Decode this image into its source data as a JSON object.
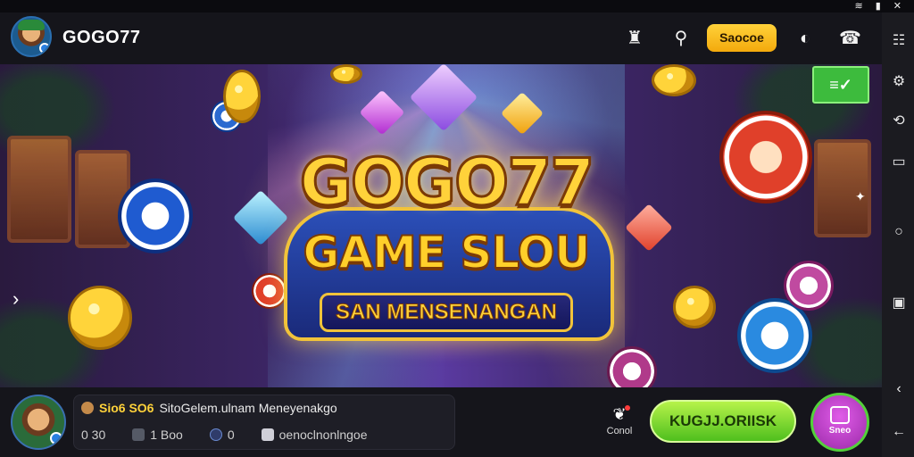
{
  "status_bar": {
    "icons": [
      "wifi-icon",
      "battery-icon",
      "close-icon"
    ]
  },
  "header": {
    "brand": "GOGO77",
    "search_button_label": "Saocoe",
    "icons": [
      "promo-icon",
      "search-icon",
      "theme-icon",
      "support-icon"
    ]
  },
  "banner": {
    "title_line1": "GOGO77",
    "title_line2": "GAME SLOU",
    "title_line3": "SAN MENSENANGAN",
    "corner_badge": "≡✓"
  },
  "player_bar": {
    "name": "Sio6 SO6",
    "title": "SitoGelem.ulnam Meneyenakgo",
    "stats": [
      {
        "icon": "",
        "value": "0 30"
      },
      {
        "icon": "grid-icon",
        "value": "1 Boo"
      },
      {
        "icon": "coin-icon",
        "value": "0"
      },
      {
        "icon": "chat-icon",
        "value": "oenoclnonlngoe"
      }
    ],
    "gift_label": "Conol",
    "cta_label": "KUGJJ.ORIISK",
    "round_button_label": "Sneo"
  },
  "colors": {
    "accent_gold": "#ffd23a",
    "cta_green": "#4fbf1e",
    "round_button_purple": "#c040d0"
  }
}
